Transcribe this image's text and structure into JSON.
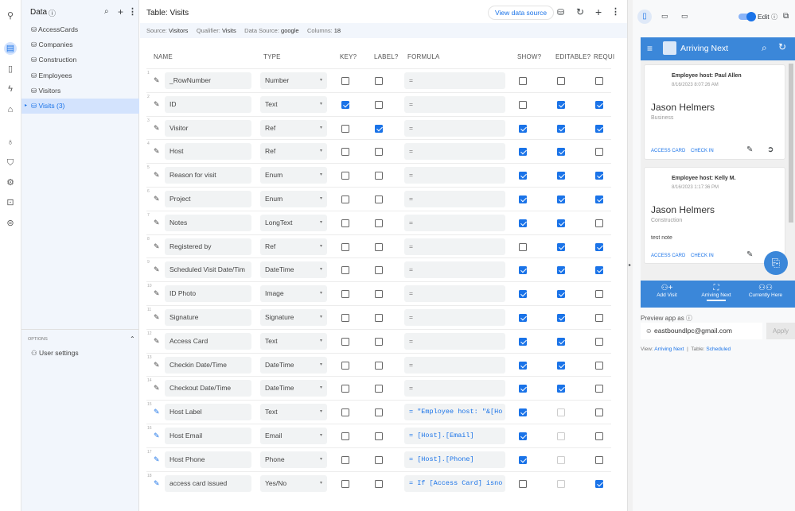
{
  "sidebar": {
    "title": "Data",
    "items": [
      {
        "label": "AccessCards"
      },
      {
        "label": "Companies"
      },
      {
        "label": "Construction"
      },
      {
        "label": "Employees"
      },
      {
        "label": "Visitors"
      },
      {
        "label": "Visits (3)",
        "selected": true
      }
    ],
    "options_label": "OPTIONS",
    "user_settings": "User settings"
  },
  "main": {
    "title": "Table: Visits",
    "view_source": "View data source",
    "meta": {
      "source_label": "Source:",
      "source": "Visitors",
      "qualifier_label": "Qualifier:",
      "qualifier": "Visits",
      "ds_label": "Data Source:",
      "ds": "google",
      "cols_label": "Columns:",
      "cols": "18"
    },
    "headers": [
      "NAME",
      "TYPE",
      "KEY?",
      "LABEL?",
      "FORMULA",
      "SHOW?",
      "EDITABLE?",
      "REQUI"
    ],
    "rows": [
      {
        "n": "1",
        "name": "_RowNumber",
        "type": "Number",
        "key": false,
        "label": false,
        "formula": "=",
        "show": false,
        "editable": false,
        "require": false
      },
      {
        "n": "2",
        "name": "ID",
        "type": "Text",
        "key": true,
        "label": false,
        "formula": "=",
        "show": false,
        "editable": true,
        "require": true
      },
      {
        "n": "3",
        "name": "Visitor",
        "type": "Ref",
        "key": false,
        "label": true,
        "formula": "=",
        "show": true,
        "editable": true,
        "require": true
      },
      {
        "n": "4",
        "name": "Host",
        "type": "Ref",
        "key": false,
        "label": false,
        "formula": "=",
        "show": true,
        "editable": true,
        "require": false
      },
      {
        "n": "5",
        "name": "Reason for visit",
        "type": "Enum",
        "key": false,
        "label": false,
        "formula": "=",
        "show": true,
        "editable": true,
        "require": true
      },
      {
        "n": "6",
        "name": "Project",
        "type": "Enum",
        "key": false,
        "label": false,
        "formula": "=",
        "show": true,
        "editable": true,
        "require": true
      },
      {
        "n": "7",
        "name": "Notes",
        "type": "LongText",
        "key": false,
        "label": false,
        "formula": "=",
        "show": true,
        "editable": true,
        "require": false
      },
      {
        "n": "8",
        "name": "Registered by",
        "type": "Ref",
        "key": false,
        "label": false,
        "formula": "=",
        "show": false,
        "editable": true,
        "require": true
      },
      {
        "n": "9",
        "name": "Scheduled Visit Date/Tim",
        "type": "DateTime",
        "key": false,
        "label": false,
        "formula": "=",
        "show": true,
        "editable": true,
        "require": true
      },
      {
        "n": "10",
        "name": "ID Photo",
        "type": "Image",
        "key": false,
        "label": false,
        "formula": "=",
        "show": true,
        "editable": true,
        "require": false
      },
      {
        "n": "11",
        "name": "Signature",
        "type": "Signature",
        "key": false,
        "label": false,
        "formula": "=",
        "show": true,
        "editable": true,
        "require": false
      },
      {
        "n": "12",
        "name": "Access Card",
        "type": "Text",
        "key": false,
        "label": false,
        "formula": "=",
        "show": true,
        "editable": true,
        "require": false
      },
      {
        "n": "13",
        "name": "Checkin Date/Time",
        "type": "DateTime",
        "key": false,
        "label": false,
        "formula": "=",
        "show": true,
        "editable": true,
        "require": false
      },
      {
        "n": "14",
        "name": "Checkout Date/Time",
        "type": "DateTime",
        "key": false,
        "label": false,
        "formula": "=",
        "show": true,
        "editable": true,
        "require": false
      },
      {
        "n": "15",
        "name": "Host Label",
        "type": "Text",
        "key": false,
        "label": false,
        "formula": "= \"Employee host: \"&[Ho",
        "virtual": true,
        "show": true,
        "editable": null,
        "require": false
      },
      {
        "n": "16",
        "name": "Host Email",
        "type": "Email",
        "key": false,
        "label": false,
        "formula": "= [Host].[Email]",
        "virtual": true,
        "show": true,
        "editable": null,
        "require": false
      },
      {
        "n": "17",
        "name": "Host Phone",
        "type": "Phone",
        "key": false,
        "label": false,
        "formula": "= [Host].[Phone]",
        "virtual": true,
        "show": true,
        "editable": null,
        "require": false
      },
      {
        "n": "18",
        "name": "access card issued",
        "type": "Yes/No",
        "key": false,
        "label": false,
        "formula": "= If [Access Card] isno",
        "virtual": true,
        "show": false,
        "editable": null,
        "require": true
      }
    ]
  },
  "preview": {
    "edit_label": "Edit",
    "app_title": "Arriving Next",
    "cards": [
      {
        "host": "Employee host: Paul Allen",
        "time": "8/16/2023 8:07:26 AM",
        "name": "Jason Helmers",
        "company": "Business",
        "note": ""
      },
      {
        "host": "Employee host: Kelly M.",
        "time": "8/16/2023 1:17:36 PM",
        "name": "Jason Helmers",
        "company": "Construction",
        "note": "test note"
      }
    ],
    "actions": [
      "ACCESS CARD",
      "CHECK IN"
    ],
    "nav": [
      {
        "label": "Add Visit",
        "icon": "person-add-icon"
      },
      {
        "label": "Arriving Next",
        "icon": "binoculars-icon",
        "active": true
      },
      {
        "label": "Currently Here",
        "icon": "people-icon"
      }
    ],
    "preview_as": "Preview app as",
    "email": "eastboundlpc@gmail.com",
    "apply": "Apply",
    "view_label": "View:",
    "view": "Arriving Next",
    "table_label": "Table:",
    "table": "Scheduled"
  },
  "colors": {
    "accent": "#1a73e8",
    "app_bar": "#3b87d9",
    "sidebar_bg": "#f2f6fc",
    "selected_bg": "#d3e3fd"
  }
}
